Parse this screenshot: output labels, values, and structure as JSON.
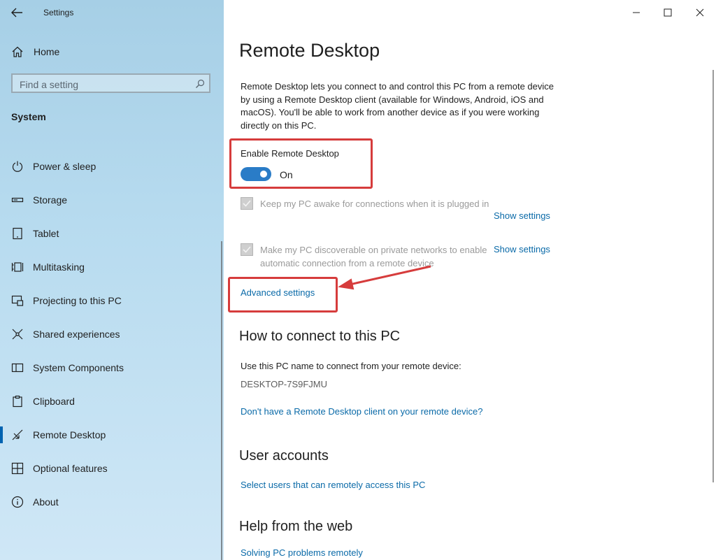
{
  "app": {
    "title": "Settings"
  },
  "sidebar": {
    "home_label": "Home",
    "search_placeholder": "Find a setting",
    "section_title": "System",
    "items": [
      {
        "label": "Power & sleep",
        "icon": "power-icon"
      },
      {
        "label": "Storage",
        "icon": "storage-icon"
      },
      {
        "label": "Tablet",
        "icon": "tablet-icon"
      },
      {
        "label": "Multitasking",
        "icon": "multitasking-icon"
      },
      {
        "label": "Projecting to this PC",
        "icon": "projecting-icon"
      },
      {
        "label": "Shared experiences",
        "icon": "shared-icon"
      },
      {
        "label": "System Components",
        "icon": "components-icon"
      },
      {
        "label": "Clipboard",
        "icon": "clipboard-icon"
      },
      {
        "label": "Remote Desktop",
        "icon": "remote-desktop-icon",
        "active": true
      },
      {
        "label": "Optional features",
        "icon": "features-icon"
      },
      {
        "label": "About",
        "icon": "info-icon"
      }
    ]
  },
  "main": {
    "title": "Remote Desktop",
    "description": "Remote Desktop lets you connect to and control this PC from a remote device by using a Remote Desktop client (available for Windows, Android, iOS and macOS). You'll be able to work from another device as if you were working directly on this PC.",
    "enable_label": "Enable Remote Desktop",
    "toggle_state": "On",
    "options": [
      {
        "text": "Keep my PC awake for connections when it is plugged in",
        "link": "Show settings",
        "checked": true
      },
      {
        "text": "Make my PC discoverable on private networks to enable automatic connection from a remote device",
        "link": "Show settings",
        "checked": true
      }
    ],
    "advanced_link": "Advanced settings",
    "connect": {
      "heading": "How to connect to this PC",
      "instruction": "Use this PC name to connect from your remote device:",
      "pc_name": "DESKTOP-7S9FJMU",
      "client_link": "Don't have a Remote Desktop client on your remote device?"
    },
    "accounts": {
      "heading": "User accounts",
      "link": "Select users that can remotely access this PC"
    },
    "help": {
      "heading": "Help from the web",
      "link": "Solving PC problems remotely"
    }
  },
  "colors": {
    "accent": "#0063b1",
    "link": "#0a6aa8",
    "annotation": "#d63c3c",
    "toggle_on": "#2a7cc7"
  }
}
